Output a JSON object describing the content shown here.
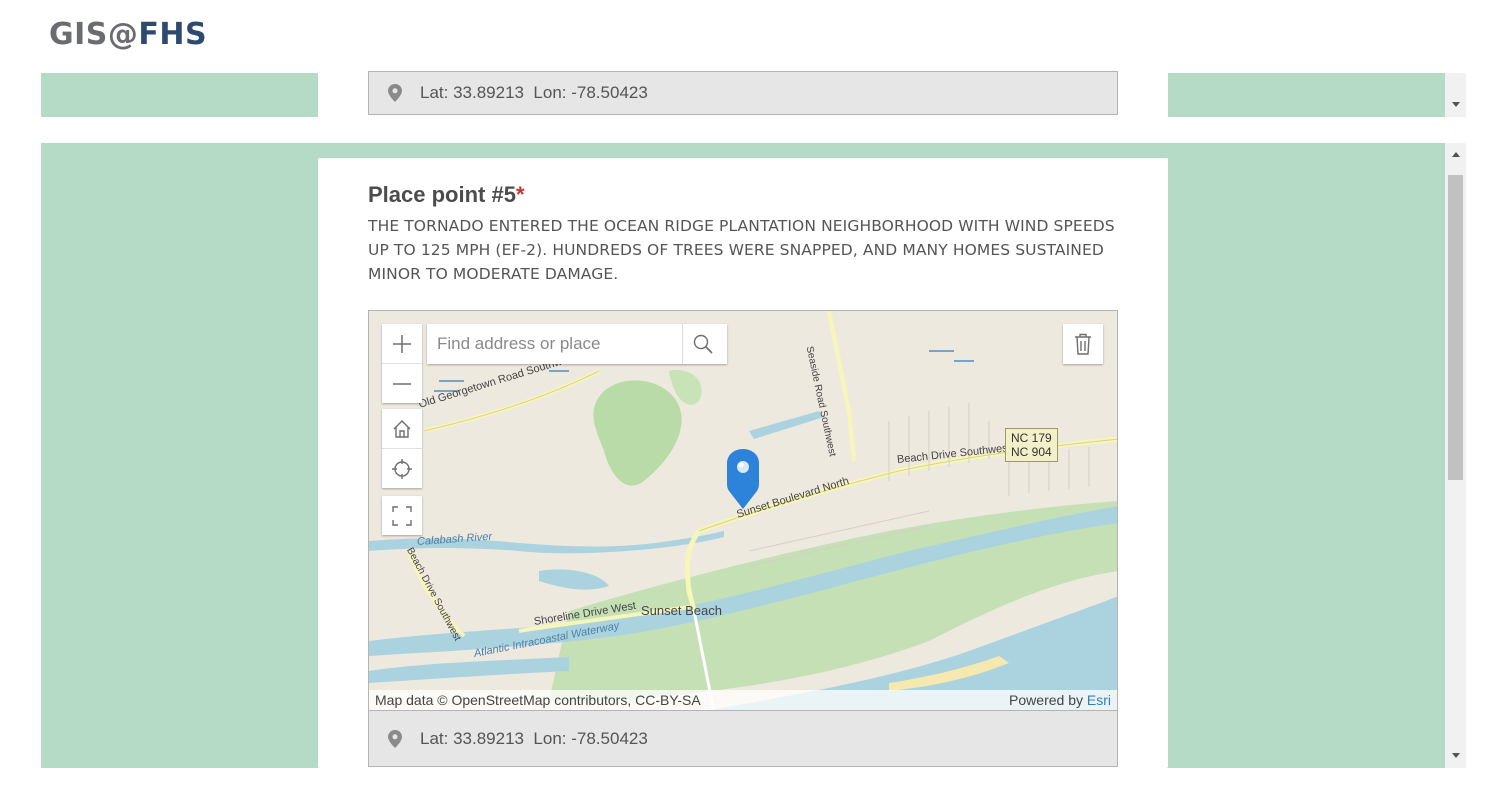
{
  "brand": {
    "left": "GIS@",
    "right": "FHS"
  },
  "previous_point": {
    "lat_lon": "Lat: 33.89213  Lon: -78.50423"
  },
  "question": {
    "title": "Place point #5",
    "required_mark": "*",
    "description": "THE TORNADO ENTERED THE OCEAN RIDGE PLANTATION NEIGHBORHOOD WITH WIND SPEEDS UP TO 125 MPH (EF-2). HUNDREDS OF TREES WERE SNAPPED, AND MANY HOMES SUSTAINED MINOR TO MODERATE DAMAGE."
  },
  "map": {
    "search_placeholder": "Find address or place",
    "labels": {
      "old_georgetown": "Old Georgetown Road Southwest",
      "seaside": "Seaside Road Southwest",
      "beach_drive": "Beach Drive Southwest",
      "sunset_blvd": "Sunset Boulevard North",
      "shoreline": "Shoreline Drive West",
      "sunset_beach": "Sunset Beach",
      "waterway": "Atlantic Intracoastal Waterway",
      "river": "Calabash River",
      "beach_drive_sw": "Beach Drive Southwest",
      "shield_1": "NC 179",
      "shield_2": "NC 904"
    },
    "attribution_left": "Map data © OpenStreetMap contributors, CC-BY-SA",
    "attribution_powered": "Powered by ",
    "attribution_esri": "Esri",
    "colors": {
      "water": "#aad3df",
      "land": "#eee9df",
      "marsh": "#c4e0b4",
      "pin": "#2d83d9"
    }
  },
  "current_point": {
    "lat_lon": "Lat: 33.89213  Lon: -78.50423"
  },
  "colors": {
    "band": "#b5dbc6",
    "required": "#c0392b"
  }
}
